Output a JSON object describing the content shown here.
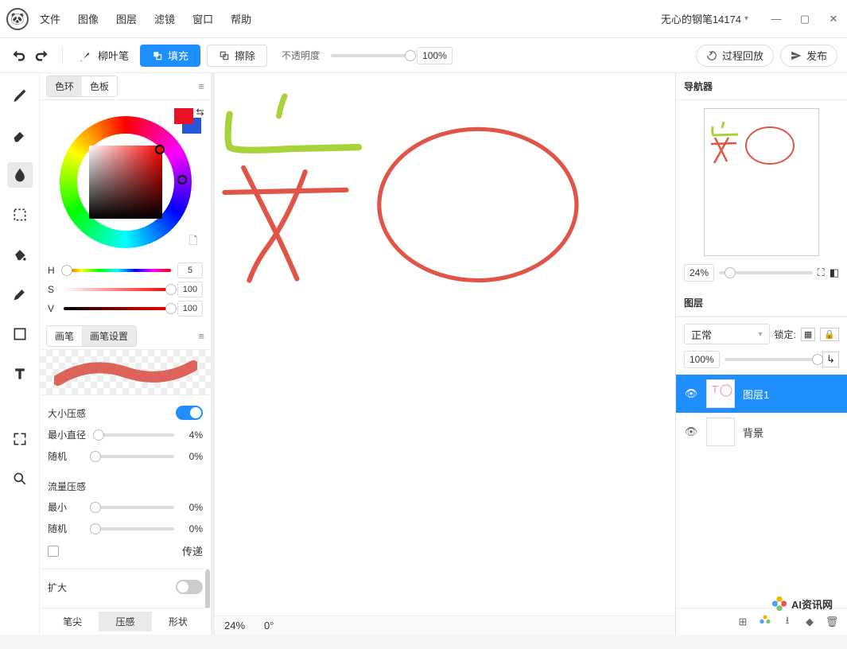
{
  "menu": {
    "file": "文件",
    "image": "图像",
    "layer": "图层",
    "filter": "滤镜",
    "window": "窗口",
    "help": "帮助"
  },
  "user": "无心的钢笔14174",
  "toolbar": {
    "brush": "柳叶笔",
    "fill": "填充",
    "erase": "擦除",
    "opacity": "不透明度",
    "opacity_val": "100%",
    "replay": "过程回放",
    "publish": "发布"
  },
  "color": {
    "tab_ring": "色环",
    "tab_swatch": "色板",
    "h": "H",
    "s": "S",
    "v": "V",
    "h_val": "5",
    "s_val": "100",
    "v_val": "100"
  },
  "brush": {
    "tab_brush": "画笔",
    "tab_settings": "画笔设置",
    "size_pressure": "大小压感",
    "min_diameter": "最小直径",
    "min_diameter_val": "4%",
    "random": "随机",
    "random_val": "0%",
    "zero": "0%",
    "flow_pressure": "流量压感",
    "min": "最小",
    "pass": "传递",
    "tip": "笔尖",
    "pressure": "压感",
    "shape": "形状",
    "extra": "扩大"
  },
  "status": {
    "zoom": "24%",
    "angle": "0°"
  },
  "nav": {
    "title": "导航器",
    "zoom": "24%"
  },
  "layers": {
    "title": "图层",
    "blend": "正常",
    "lock": "锁定:",
    "opacity": "100%",
    "layer1": "图层1",
    "bg": "背景"
  },
  "watermark": "AI资讯网"
}
